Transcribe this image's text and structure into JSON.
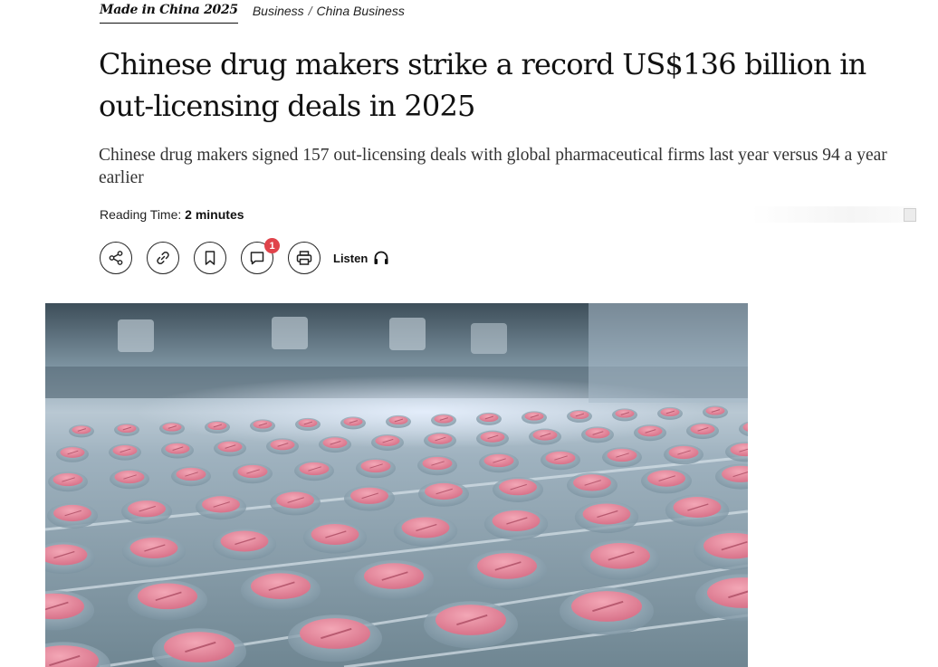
{
  "article": {
    "topic_tag": "Made in China 2025",
    "breadcrumb": [
      "Business",
      "China Business"
    ],
    "breadcrumb_separator": "/",
    "headline": "Chinese drug makers strike a record US$136 billion in out-licensing deals in 2025",
    "standfirst": "Chinese drug makers signed 157 out-licensing deals with global pharmaceutical firms last year versus 94 a year earlier",
    "reading_time_label": "Reading Time:",
    "reading_time_value": "2 minutes"
  },
  "toolbar": {
    "share_icon": "share-icon",
    "link_icon": "link-icon",
    "bookmark_icon": "bookmark-icon",
    "comment_icon": "comment-icon",
    "comment_count": "1",
    "print_icon": "print-icon",
    "listen_label": "Listen",
    "listen_icon": "headphones-icon"
  },
  "colors": {
    "badge": "#e0434b",
    "text": "#111111",
    "pill": "#ea8a9e"
  }
}
